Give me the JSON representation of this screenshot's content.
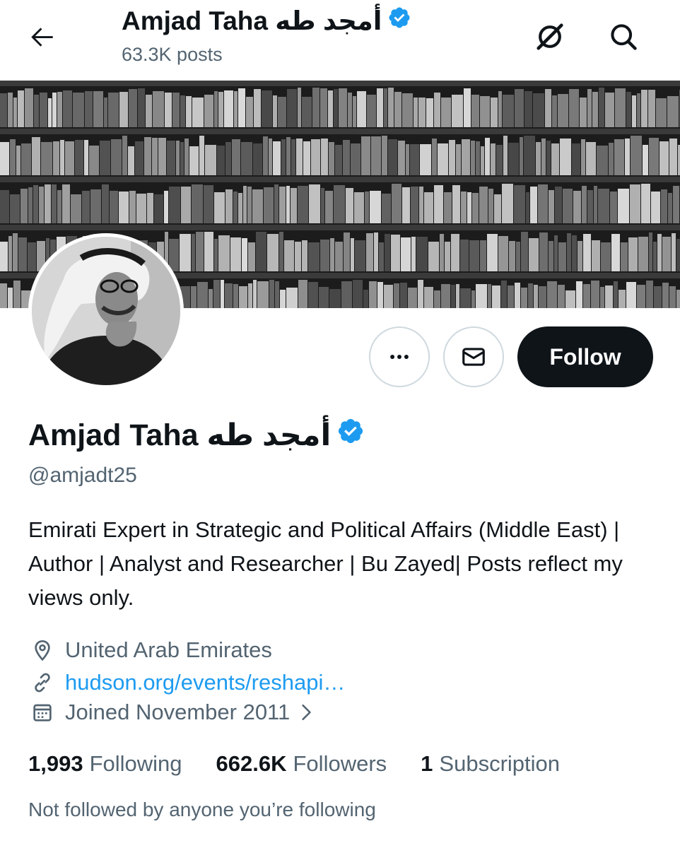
{
  "header": {
    "title": "Amjad Taha أمجد طه",
    "post_count": "63.3K posts",
    "icons": [
      "back-arrow-icon",
      "grok-icon",
      "search-icon"
    ]
  },
  "profile": {
    "display_name": "Amjad Taha أمجد طه",
    "handle": "@amjadt25",
    "verified": true,
    "bio": "Emirati Expert in Strategic and Political Affairs (Middle East) | Author | Analyst and Researcher | Bu Zayed| Posts reflect my views only.",
    "location": "United Arab Emirates",
    "website": "hudson.org/events/reshapi…",
    "joined": "Joined November 2011"
  },
  "actions": {
    "follow_label": "Follow"
  },
  "stats": {
    "following_count": "1,993",
    "following_label": "Following",
    "followers_count": "662.6K",
    "followers_label": "Followers",
    "subscription_count": "1",
    "subscription_label": "Subscription"
  },
  "footer": {
    "note": "Not followed by anyone you’re following"
  },
  "colors": {
    "accent": "#1d9bf0",
    "text": "#0f1419",
    "muted": "#536471",
    "button_dark": "#0f1419",
    "border": "#cfd9de"
  }
}
